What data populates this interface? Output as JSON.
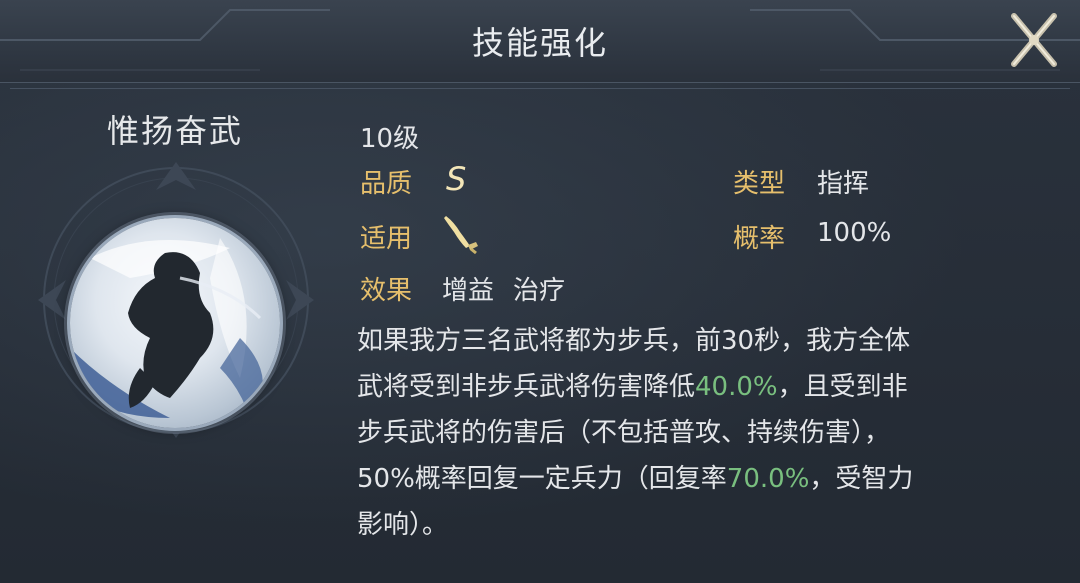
{
  "header": {
    "title": "技能强化"
  },
  "skill": {
    "name": "惟扬奋武",
    "level": "10级",
    "quality_label": "品质",
    "quality_value": "S",
    "type_label": "类型",
    "type_value": "指挥",
    "applies_label": "适用",
    "applies_icon": "saber-icon",
    "rate_label": "概率",
    "rate_value": "100%",
    "effect_label": "效果",
    "effect_tags": [
      "增益",
      "治疗"
    ]
  },
  "description": {
    "line1": "如果我方三名武将都为步兵，前30秒，我方全体",
    "line2_a": "武将受到非步兵武将伤害降低",
    "line2_hl": "40.0%",
    "line2_b": "，且受到非",
    "line3": "步兵武将的伤害后（不包括普攻、持续伤害），",
    "line4_a": "50%概率回复一定兵力（回复率",
    "line4_hl": "70.0%",
    "line4_b": "，受智力",
    "line5": "影响）。"
  },
  "colors": {
    "label_gold": "#e6bf6c",
    "highlight_green": "#79bf7f",
    "panel_bg": "#252c36"
  }
}
